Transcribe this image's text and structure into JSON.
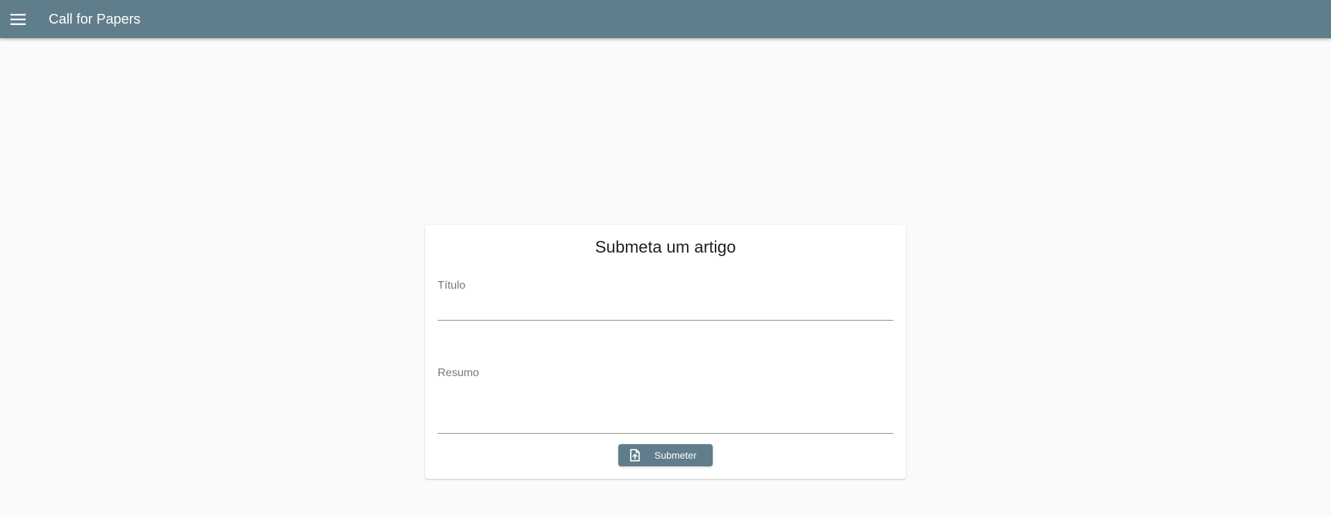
{
  "toolbar": {
    "title": "Call for Papers",
    "menu_icon": "menu-icon",
    "color": "#607d8b"
  },
  "form": {
    "heading": "Submeta um artigo",
    "titulo": {
      "label": "Título",
      "value": ""
    },
    "resumo": {
      "label": "Resumo",
      "value": ""
    },
    "submit": {
      "label": "Submeter",
      "icon": "file-upload-icon"
    }
  }
}
